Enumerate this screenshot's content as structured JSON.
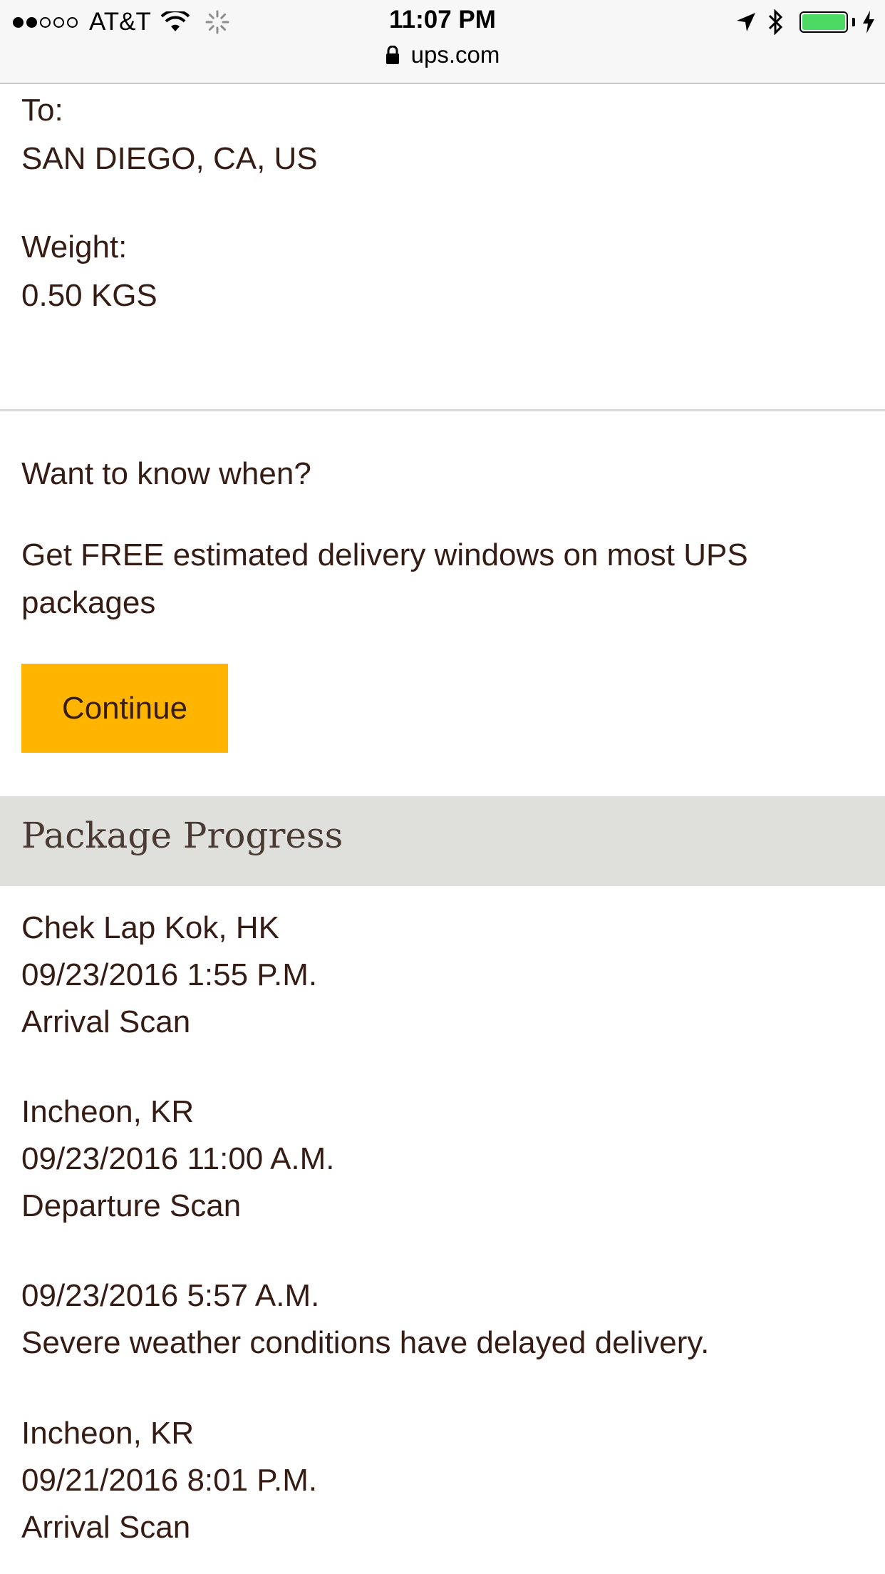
{
  "status_bar": {
    "carrier": "AT&T",
    "signal_bars_filled": 2,
    "signal_bars_total": 5,
    "time": "11:07 PM",
    "battery_level": 1.0,
    "battery_color": "#4cd964"
  },
  "browser": {
    "url": "ups.com"
  },
  "shipment": {
    "to_label": "To:",
    "to_value": "SAN DIEGO, CA, US",
    "weight_label": "Weight:",
    "weight_value": "0.50 KGS"
  },
  "cta": {
    "title": "Want to know when?",
    "text": "Get FREE estimated delivery windows on most UPS packages",
    "button_label": "Continue",
    "button_color": "#ffb500"
  },
  "progress": {
    "title": "Package Progress",
    "activities": [
      {
        "location": "Chek Lap Kok, HK",
        "datetime": "09/23/2016 1:55 P.M.",
        "status": "Arrival Scan"
      },
      {
        "location": "Incheon, KR",
        "datetime": "09/23/2016 11:00 A.M.",
        "status": "Departure Scan"
      },
      {
        "location": "",
        "datetime": "09/23/2016 5:57 A.M.",
        "status": "Severe weather conditions have delayed delivery."
      },
      {
        "location": "Incheon, KR",
        "datetime": "09/21/2016 8:01 P.M.",
        "status": "Arrival Scan"
      }
    ]
  },
  "colors": {
    "text": "#351c15",
    "header_bg": "#dfdfdb"
  }
}
